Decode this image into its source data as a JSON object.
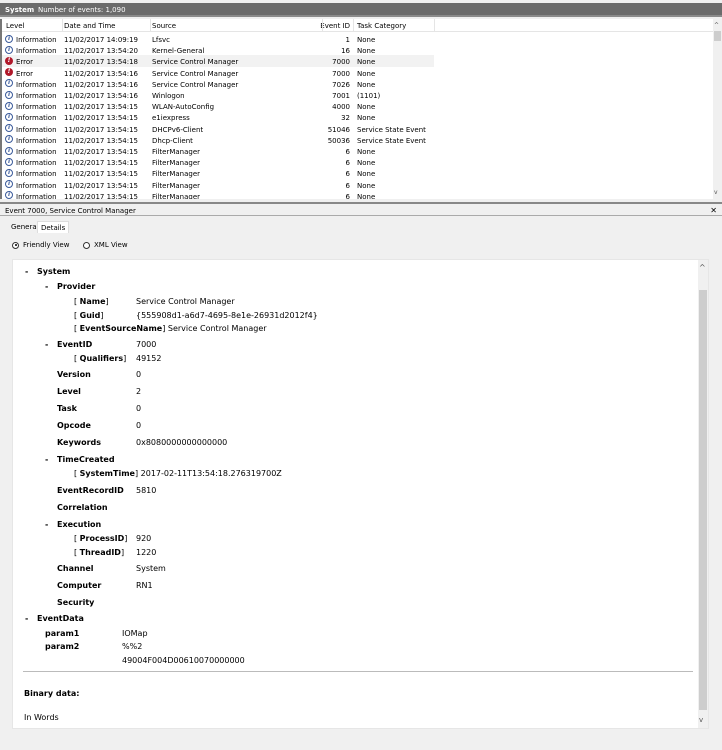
{
  "header": {
    "title": "System",
    "event_count": "Number of events: 1,090"
  },
  "columns": [
    "Level",
    "Date and Time",
    "Source",
    "Event ID",
    "Task Category"
  ],
  "rows": [
    {
      "level": "Information",
      "icon": "info",
      "date": "11/02/2017 14:09:19",
      "source": "Lfsvc",
      "id": "1",
      "task": "None"
    },
    {
      "level": "Information",
      "icon": "info",
      "date": "11/02/2017 13:54:20",
      "source": "Kernel-General",
      "id": "16",
      "task": "None"
    },
    {
      "level": "Error",
      "icon": "error",
      "date": "11/02/2017 13:54:18",
      "source": "Service Control Manager",
      "id": "7000",
      "task": "None"
    },
    {
      "level": "Error",
      "icon": "error",
      "date": "11/02/2017 13:54:16",
      "source": "Service Control Manager",
      "id": "7000",
      "task": "None"
    },
    {
      "level": "Information",
      "icon": "info",
      "date": "11/02/2017 13:54:16",
      "source": "Service Control Manager",
      "id": "7026",
      "task": "None"
    },
    {
      "level": "Information",
      "icon": "info",
      "date": "11/02/2017 13:54:16",
      "source": "Winlogon",
      "id": "7001",
      "task": "(1101)"
    },
    {
      "level": "Information",
      "icon": "info",
      "date": "11/02/2017 13:54:15",
      "source": "WLAN-AutoConfig",
      "id": "4000",
      "task": "None"
    },
    {
      "level": "Information",
      "icon": "info",
      "date": "11/02/2017 13:54:15",
      "source": "e1iexpress",
      "id": "32",
      "task": "None"
    },
    {
      "level": "Information",
      "icon": "info",
      "date": "11/02/2017 13:54:15",
      "source": "DHCPv6-Client",
      "id": "51046",
      "task": "Service State Event"
    },
    {
      "level": "Information",
      "icon": "info",
      "date": "11/02/2017 13:54:15",
      "source": "Dhcp-Client",
      "id": "50036",
      "task": "Service State Event"
    },
    {
      "level": "Information",
      "icon": "info",
      "date": "11/02/2017 13:54:15",
      "source": "FilterManager",
      "id": "6",
      "task": "None"
    },
    {
      "level": "Information",
      "icon": "info",
      "date": "11/02/2017 13:54:15",
      "source": "FilterManager",
      "id": "6",
      "task": "None"
    },
    {
      "level": "Information",
      "icon": "info",
      "date": "11/02/2017 13:54:15",
      "source": "FilterManager",
      "id": "6",
      "task": "None"
    },
    {
      "level": "Information",
      "icon": "info",
      "date": "11/02/2017 13:54:15",
      "source": "FilterManager",
      "id": "6",
      "task": "None"
    },
    {
      "level": "Information",
      "icon": "info",
      "date": "11/02/2017 13:54:15",
      "source": "FilterManager",
      "id": "6",
      "task": "None"
    }
  ],
  "selected_row": 2,
  "pane": {
    "title": "Event 7000, Service Control Manager",
    "tabs": [
      "General",
      "Details"
    ],
    "active_tab": "Details",
    "views": [
      "Friendly View",
      "XML View"
    ],
    "selected_view": "Friendly View"
  },
  "details": {
    "system": "System",
    "provider": "Provider",
    "name_key": "Name",
    "name_val": "Service Control Manager",
    "guid_key": "Guid",
    "guid_val": "{555908d1-a6d7-4695-8e1e-26931d2012f4}",
    "esn_key": "EventSourceName",
    "esn_val": "Service Control Manager",
    "eventid_key": "EventID",
    "eventid_val": "7000",
    "qual_key": "Qualifiers",
    "qual_val": "49152",
    "version_key": "Version",
    "version_val": "0",
    "level_key": "Level",
    "level_val": "2",
    "task_key": "Task",
    "task_val": "0",
    "opcode_key": "Opcode",
    "opcode_val": "0",
    "keywords_key": "Keywords",
    "keywords_val": "0x8080000000000000",
    "timecreated": "TimeCreated",
    "systime_key": "SystemTime",
    "systime_val": "2017-02-11T13:54:18.276319700Z",
    "recid_key": "EventRecordID",
    "recid_val": "5810",
    "correlation": "Correlation",
    "execution": "Execution",
    "pid_key": "ProcessID",
    "pid_val": "920",
    "tid_key": "ThreadID",
    "tid_val": "1220",
    "channel_key": "Channel",
    "channel_val": "System",
    "computer_key": "Computer",
    "computer_val": "RN1",
    "security": "Security",
    "eventdata": "EventData",
    "param1_key": "param1",
    "param1_val": "IOMap",
    "param2_key": "param2",
    "param2_val": "%%2",
    "param2_extra": "49004F004D00610070000000",
    "binary": "Binary data:",
    "inwords": "In Words"
  }
}
